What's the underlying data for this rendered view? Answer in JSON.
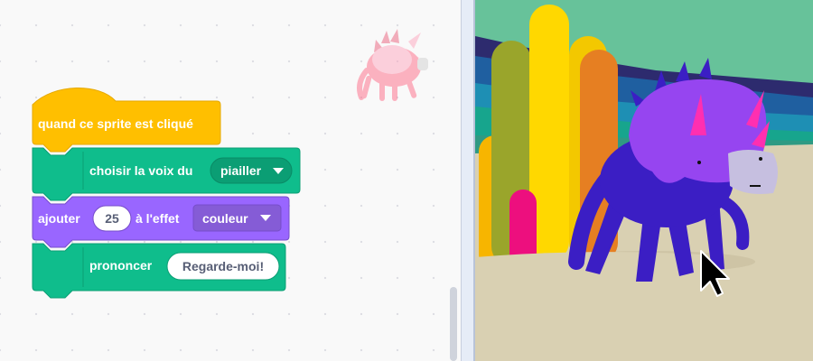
{
  "code_area": {
    "hat_block": {
      "label": "quand ce sprite est cliqué",
      "color": "#ffbf00"
    },
    "voice_block": {
      "label": "choisir la voix du",
      "dropdown_value": "piailler",
      "color": "#0fbd8c",
      "icon": "text-to-speech-extension-icon"
    },
    "effect_block": {
      "label_before": "ajouter",
      "number_value": "25",
      "label_after": "à l'effet",
      "dropdown_value": "couleur",
      "color": "#9966ff"
    },
    "speak_block": {
      "label": "prononcer",
      "text_value": "Regarde-moi!",
      "color": "#0fbd8c",
      "icon": "text-to-speech-extension-icon"
    },
    "sprite_thumbnail": "triceratops-sprite-icon"
  },
  "stage": {
    "background": "beach-cactus-backdrop",
    "sprite": "purple-triceratops-sprite",
    "cursor": "mouse-pointer-icon"
  }
}
